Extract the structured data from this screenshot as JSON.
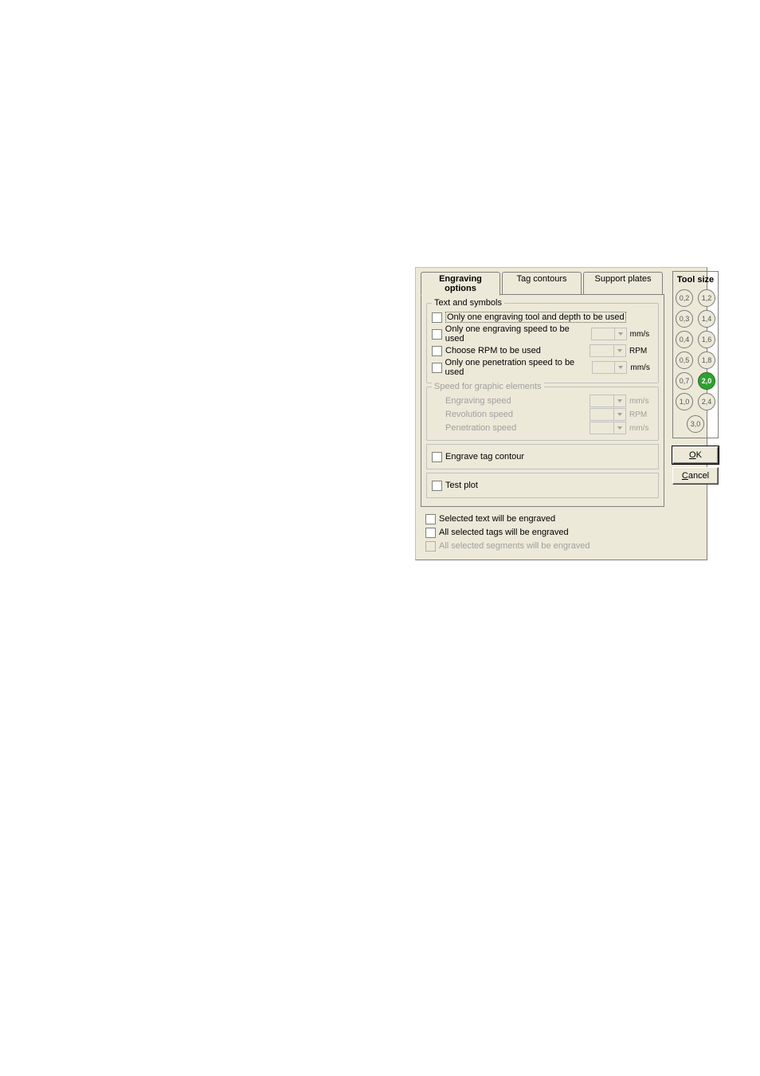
{
  "tabs": {
    "engraving_options": "Engraving options",
    "tag_contours": "Tag contours",
    "support_plates": "Support plates"
  },
  "text_symbols": {
    "legend": "Text and symbols",
    "only_one_tool_depth": "Only one engraving tool and depth to be used",
    "only_one_engraving_speed": "Only one engraving speed to be used",
    "choose_rpm": "Choose RPM to be used",
    "only_one_penetration_speed": "Only one penetration speed  to be used",
    "unit_mms": "mm/s",
    "unit_rpm": "RPM"
  },
  "graphic_speed": {
    "legend": "Speed for graphic elements",
    "engraving_speed": "Engraving speed",
    "revolution_speed": "Revolution speed",
    "penetration_speed": "Penetration speed"
  },
  "engrave_tag_contour": "Engrave tag contour",
  "test_plot": "Test plot",
  "bottom": {
    "selected_text": "Selected text will be engraved",
    "all_selected_tags": "All selected tags will be engraved",
    "all_selected_segments": "All selected segments will be engraved"
  },
  "toolsize": {
    "title": "Tool size",
    "sizes": [
      "0,2",
      "1,2",
      "0,3",
      "1,4",
      "0,4",
      "1,6",
      "0,5",
      "1,8",
      "0,7",
      "2,0",
      "1,0",
      "2,4",
      "3,0"
    ],
    "selected_index": 9
  },
  "buttons": {
    "ok_pre": "",
    "ok_u": "O",
    "ok_post": "K",
    "cancel_pre": "",
    "cancel_u": "C",
    "cancel_post": "ancel"
  }
}
